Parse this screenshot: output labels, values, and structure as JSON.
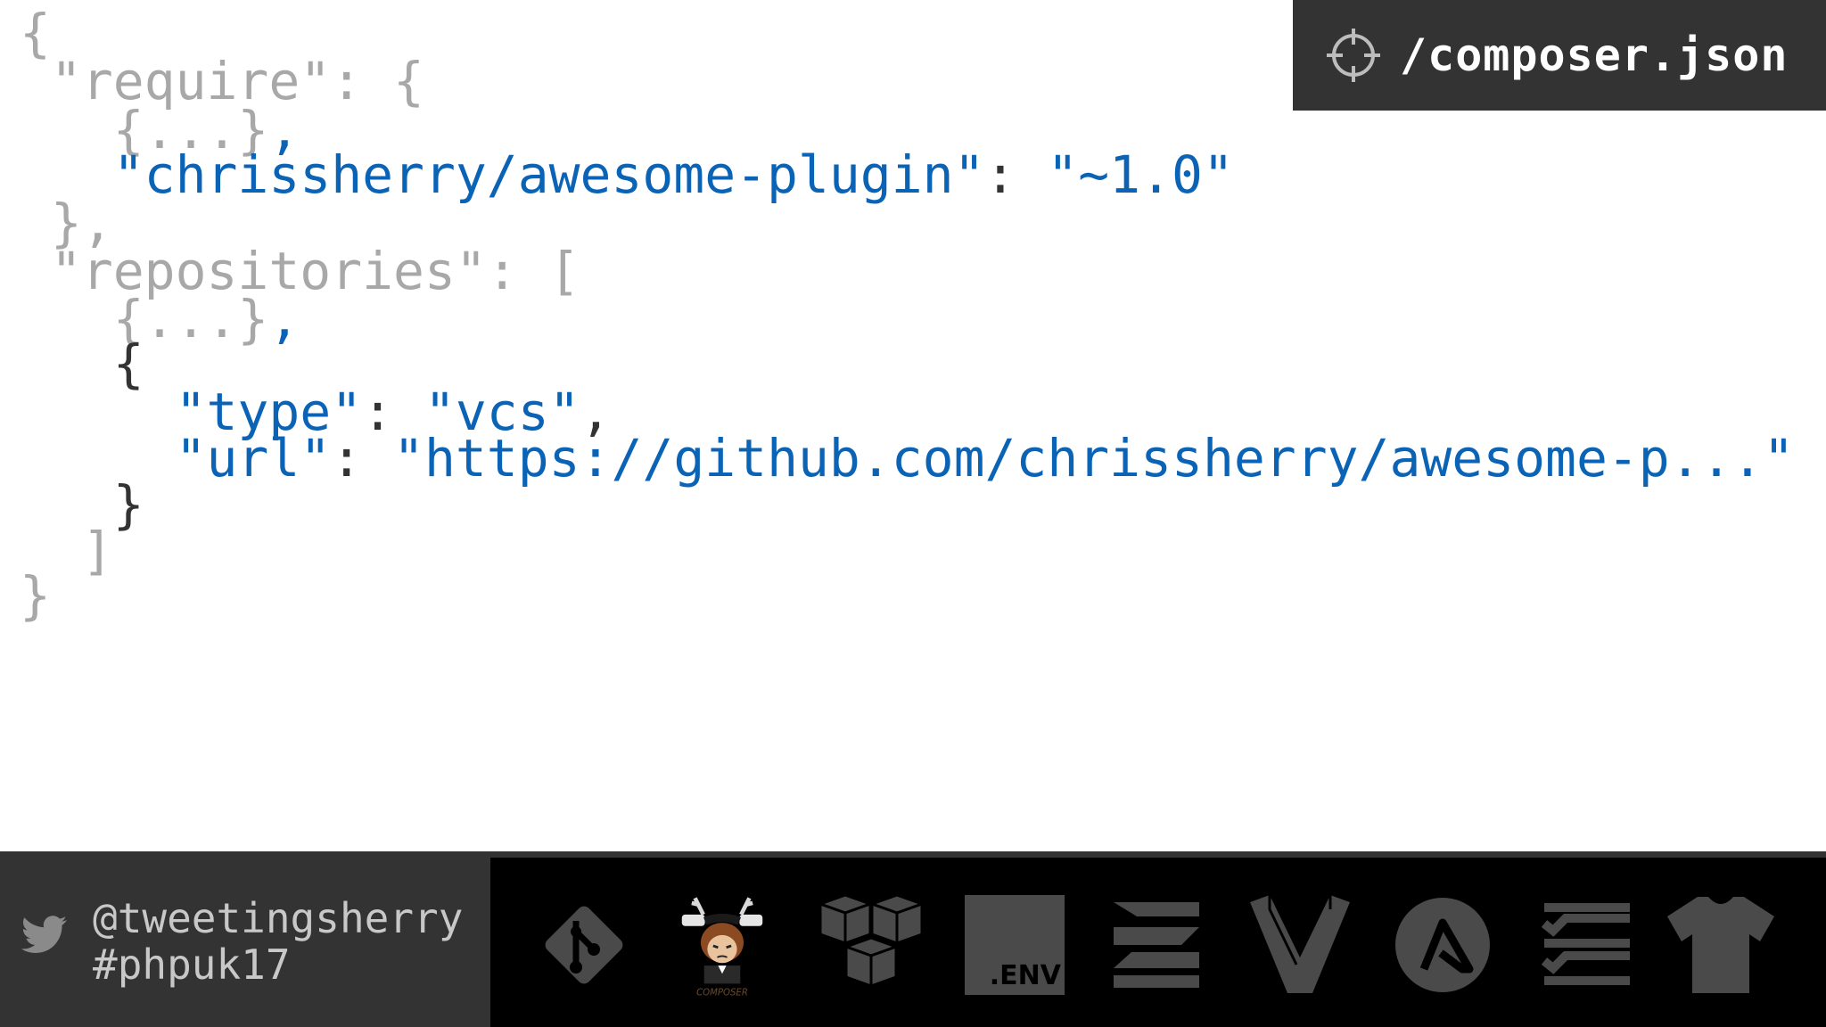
{
  "file_badge": {
    "icon": "crosshair-icon",
    "label": "/composer.json"
  },
  "code_lines": [
    {
      "segments": [
        {
          "t": "{",
          "c": "g"
        }
      ]
    },
    {
      "segments": [
        {
          "t": " \"require\": {",
          "c": "g"
        }
      ]
    },
    {
      "segments": [
        {
          "t": "   {...}",
          "c": "g"
        },
        {
          "t": ",",
          "c": "b"
        }
      ]
    },
    {
      "segments": [
        {
          "t": "   \"chrissherry/awesome-plugin\"",
          "c": "b"
        },
        {
          "t": ": ",
          "c": "k"
        },
        {
          "t": "\"~1.0\"",
          "c": "b"
        }
      ]
    },
    {
      "segments": [
        {
          "t": " },",
          "c": "g"
        }
      ]
    },
    {
      "segments": [
        {
          "t": " \"repositories\": [",
          "c": "g"
        }
      ]
    },
    {
      "segments": [
        {
          "t": "   {...}",
          "c": "g"
        },
        {
          "t": ",",
          "c": "b"
        }
      ]
    },
    {
      "segments": [
        {
          "t": "   {",
          "c": "k"
        }
      ]
    },
    {
      "segments": [
        {
          "t": "     \"type\"",
          "c": "b"
        },
        {
          "t": ": ",
          "c": "k"
        },
        {
          "t": "\"vcs\"",
          "c": "b"
        },
        {
          "t": ",",
          "c": "k"
        }
      ]
    },
    {
      "segments": [
        {
          "t": "     \"url\"",
          "c": "b"
        },
        {
          "t": ": ",
          "c": "k"
        },
        {
          "t": "\"https://github.com/chrissherry/awesome-p...\"",
          "c": "b"
        }
      ]
    },
    {
      "segments": [
        {
          "t": "   }",
          "c": "k"
        }
      ]
    },
    {
      "segments": [
        {
          "t": "  ]",
          "c": "g"
        }
      ]
    },
    {
      "segments": [
        {
          "t": "}",
          "c": "g"
        }
      ]
    }
  ],
  "footer": {
    "handle": "@tweetingsherry",
    "hashtag": "#phpuk17",
    "bird_icon": "twitter-bird-icon",
    "tools": [
      {
        "name": "git-logo"
      },
      {
        "name": "composer-logo",
        "caption": "COMPOSER"
      },
      {
        "name": "aws-cubes-logo"
      },
      {
        "name": "dotenv-logo",
        "text": ".ENV"
      },
      {
        "name": "zend-logo"
      },
      {
        "name": "vagrant-logo"
      },
      {
        "name": "ansible-logo"
      },
      {
        "name": "checklist-logo"
      },
      {
        "name": "jersey-logo"
      }
    ]
  },
  "colors": {
    "key_blue": "#0b63b6",
    "muted_gray": "#a8a8a8",
    "badge_bg": "#333333",
    "footer_bg": "#000000"
  }
}
